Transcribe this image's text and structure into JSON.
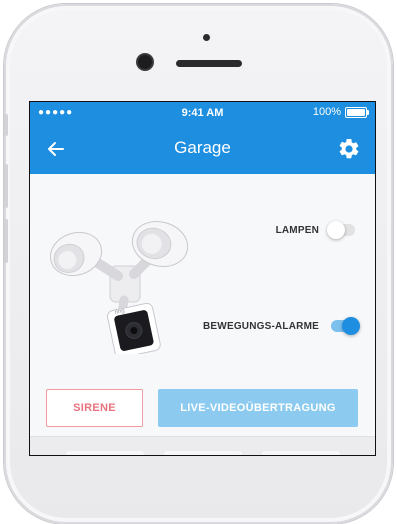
{
  "status_bar": {
    "signal": "●●●●●",
    "time": "9:41 AM",
    "battery": "100%"
  },
  "nav": {
    "title": "Garage",
    "back_icon": "arrow-left-icon",
    "settings_icon": "gear-icon"
  },
  "device": {
    "image_icon": "floodlight-camera-icon",
    "brand_mark": "ring"
  },
  "toggles": [
    {
      "label": "LAMPEN",
      "state": "off"
    },
    {
      "label": "BEWEGUNGS-ALARME",
      "state": "on"
    }
  ],
  "actions": {
    "siren_label": "SIRENE",
    "live_label": "LIVE-VIDEOÜBERTRAGUNG"
  },
  "colors": {
    "primary": "#1e8fe0",
    "siren": "#e8737e",
    "live": "#8ccbef"
  }
}
